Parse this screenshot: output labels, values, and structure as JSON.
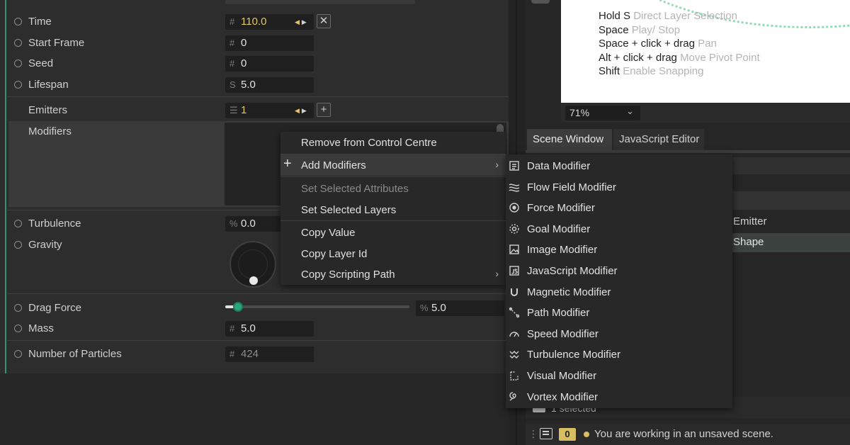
{
  "properties": {
    "time": {
      "label": "Time",
      "prefix": "#",
      "value": "110.0"
    },
    "start_frame": {
      "label": "Start Frame",
      "prefix": "#",
      "value": "0"
    },
    "seed": {
      "label": "Seed",
      "prefix": "#",
      "value": "0"
    },
    "lifespan": {
      "label": "Lifespan",
      "prefix": "S",
      "value": "5.0"
    },
    "emitters": {
      "label": "Emitters",
      "value": "1"
    },
    "modifiers": {
      "label": "Modifiers"
    },
    "turbulence": {
      "label": "Turbulence",
      "prefix": "%",
      "value": "0.0"
    },
    "gravity": {
      "label": "Gravity"
    },
    "drag_force": {
      "label": "Drag Force",
      "prefix": "%",
      "value": "5.0"
    },
    "mass": {
      "label": "Mass",
      "prefix": "#",
      "value": "5.0"
    },
    "num_particles": {
      "label": "Number of Particles",
      "prefix": "#",
      "value": "424"
    }
  },
  "controls": {
    "clear_symbol": "✕",
    "add_symbol": "+",
    "arrow_left": "◀",
    "arrow_right": "▶"
  },
  "preview": {
    "hints": [
      {
        "key": "Hold S",
        "desc": "Direct Layer Selection"
      },
      {
        "key": "Space",
        "desc": "Play/ Stop"
      },
      {
        "key": "Space + click + drag",
        "desc": "Pan"
      },
      {
        "key": "Alt + click + drag",
        "desc": "Move Pivot Point"
      },
      {
        "key": "Shift",
        "desc": "Enable Snapping"
      }
    ],
    "zoom": "71%"
  },
  "tabs": [
    {
      "label": "Scene Window",
      "active": true
    },
    {
      "label": "JavaScript Editor",
      "active": false
    }
  ],
  "scene": {
    "emitter_label": "Emitter",
    "shape_label": "Shape",
    "selected_text": "1 selected"
  },
  "status": {
    "badge": "0",
    "message": "You are working in an unsaved scene."
  },
  "context_menu": {
    "remove": "Remove from Control Centre",
    "add_modifiers": "Add Modifiers",
    "set_selected_attributes": "Set Selected Attributes",
    "set_selected_layers": "Set Selected Layers",
    "copy_value": "Copy Value",
    "copy_layer_id": "Copy Layer Id",
    "copy_scripting_path": "Copy Scripting Path"
  },
  "modifiers_submenu": [
    {
      "label": "Data Modifier",
      "icon": "data-modifier-icon"
    },
    {
      "label": "Flow Field Modifier",
      "icon": "flow-field-modifier-icon"
    },
    {
      "label": "Force Modifier",
      "icon": "force-modifier-icon"
    },
    {
      "label": "Goal Modifier",
      "icon": "goal-modifier-icon"
    },
    {
      "label": "Image Modifier",
      "icon": "image-modifier-icon"
    },
    {
      "label": "JavaScript Modifier",
      "icon": "javascript-modifier-icon"
    },
    {
      "label": "Magnetic Modifier",
      "icon": "magnetic-modifier-icon"
    },
    {
      "label": "Path Modifier",
      "icon": "path-modifier-icon"
    },
    {
      "label": "Speed Modifier",
      "icon": "speed-modifier-icon"
    },
    {
      "label": "Turbulence Modifier",
      "icon": "turbulence-modifier-icon"
    },
    {
      "label": "Visual Modifier",
      "icon": "visual-modifier-icon"
    },
    {
      "label": "Vortex Modifier",
      "icon": "vortex-modifier-icon"
    }
  ],
  "colors": {
    "accent_green": "#2aa67c",
    "gold": "#e3c566",
    "badge": "#d8be62"
  }
}
